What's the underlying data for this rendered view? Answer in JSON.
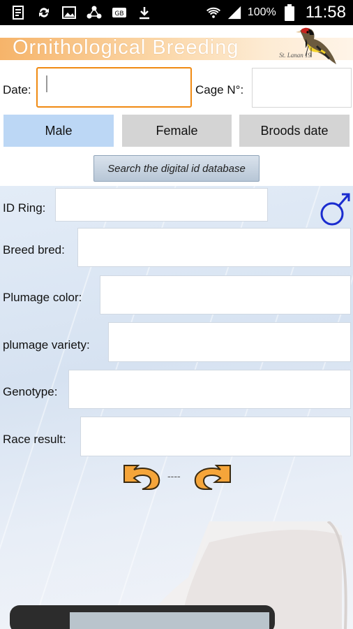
{
  "status_bar": {
    "battery_percent": "100%",
    "time": "11:58",
    "icons": [
      "screenshot-icon",
      "sync-icon",
      "gallery-icon",
      "share-icon",
      "gb-icon",
      "download-icon",
      "wifi-icon",
      "signal-icon",
      "battery-icon"
    ]
  },
  "header": {
    "title": "Ornithological Breeding",
    "logo": "goldfinch-bird-icon",
    "accent": "#f6b46a"
  },
  "form_top": {
    "date_label": "Date:",
    "date_value": "",
    "cage_label": "Cage N°:",
    "cage_value": ""
  },
  "tabs": [
    {
      "label": "Male",
      "active": true
    },
    {
      "label": "Female",
      "active": false
    },
    {
      "label": "Broods date",
      "active": false
    }
  ],
  "search_button_label": "Search the digital id database",
  "male_form": {
    "symbol": "male-symbol-icon",
    "fields": [
      {
        "label": "ID Ring:",
        "value": ""
      },
      {
        "label": "Breed bred:",
        "value": ""
      },
      {
        "label": "Plumage color:",
        "value": ""
      },
      {
        "label": "plumage variety:",
        "value": ""
      },
      {
        "label": "Genotype:",
        "value": ""
      },
      {
        "label": "Race result:",
        "value": ""
      }
    ]
  },
  "navigation": {
    "back_icon": "undo-arrow-icon",
    "separator": "----",
    "forward_icon": "redo-arrow-icon",
    "arrow_color": "#f5a53a"
  }
}
